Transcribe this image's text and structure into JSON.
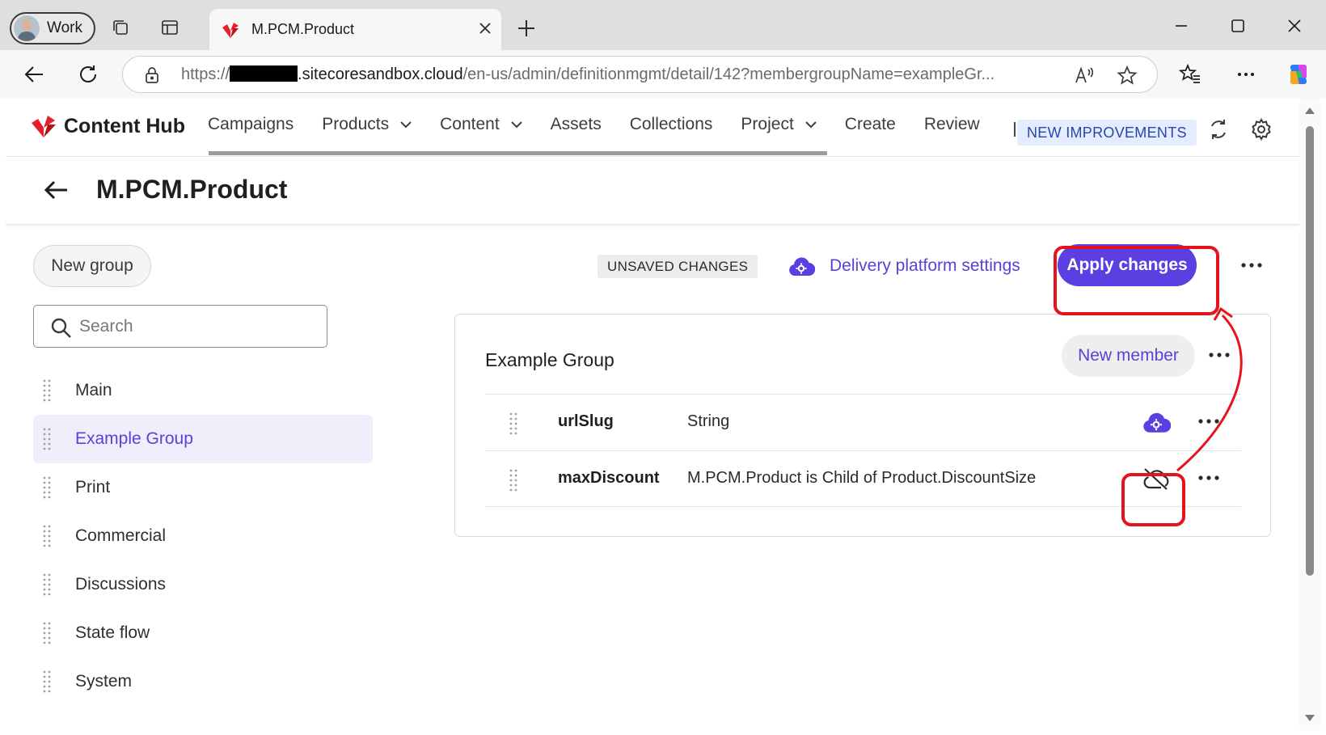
{
  "browser": {
    "profile_label": "Work",
    "tab_title": "M.PCM.Product",
    "url_prefix": "https://",
    "url_host": ".sitecoresandbox.cloud",
    "url_path": "/en-us/admin/definitionmgmt/detail/142?membergroupName=exampleGr..."
  },
  "app": {
    "brand": "Content Hub",
    "brand_color": "#e4202e",
    "accent_color": "#5b3fe0",
    "nav": [
      {
        "label": "Campaigns",
        "dropdown": false
      },
      {
        "label": "Products",
        "dropdown": true
      },
      {
        "label": "Content",
        "dropdown": true
      },
      {
        "label": "Assets",
        "dropdown": false
      },
      {
        "label": "Collections",
        "dropdown": false
      },
      {
        "label": "Project",
        "dropdown": true
      },
      {
        "label": "Create",
        "dropdown": false
      },
      {
        "label": "Review",
        "dropdown": false
      }
    ],
    "new_improvements": "NEW IMPROVEMENTS"
  },
  "page": {
    "title": "M.PCM.Product",
    "new_group_label": "New group",
    "search_placeholder": "Search",
    "groups": [
      {
        "label": "Main",
        "active": false
      },
      {
        "label": "Example Group",
        "active": true
      },
      {
        "label": "Print",
        "active": false
      },
      {
        "label": "Commercial",
        "active": false
      },
      {
        "label": "Discussions",
        "active": false
      },
      {
        "label": "State flow",
        "active": false
      },
      {
        "label": "System",
        "active": false
      }
    ],
    "unsaved_badge": "UNSAVED CHANGES",
    "delivery_platform_settings": "Delivery platform settings",
    "apply_changes": "Apply changes",
    "group_panel": {
      "title": "Example Group",
      "new_member_label": "New member",
      "members": [
        {
          "name": "urlSlug",
          "type": "String",
          "icon": "cloud-settings-icon"
        },
        {
          "name": "maxDiscount",
          "type": "M.PCM.Product is Child of Product.DiscountSize",
          "icon": "cloud-off-icon"
        }
      ]
    }
  }
}
